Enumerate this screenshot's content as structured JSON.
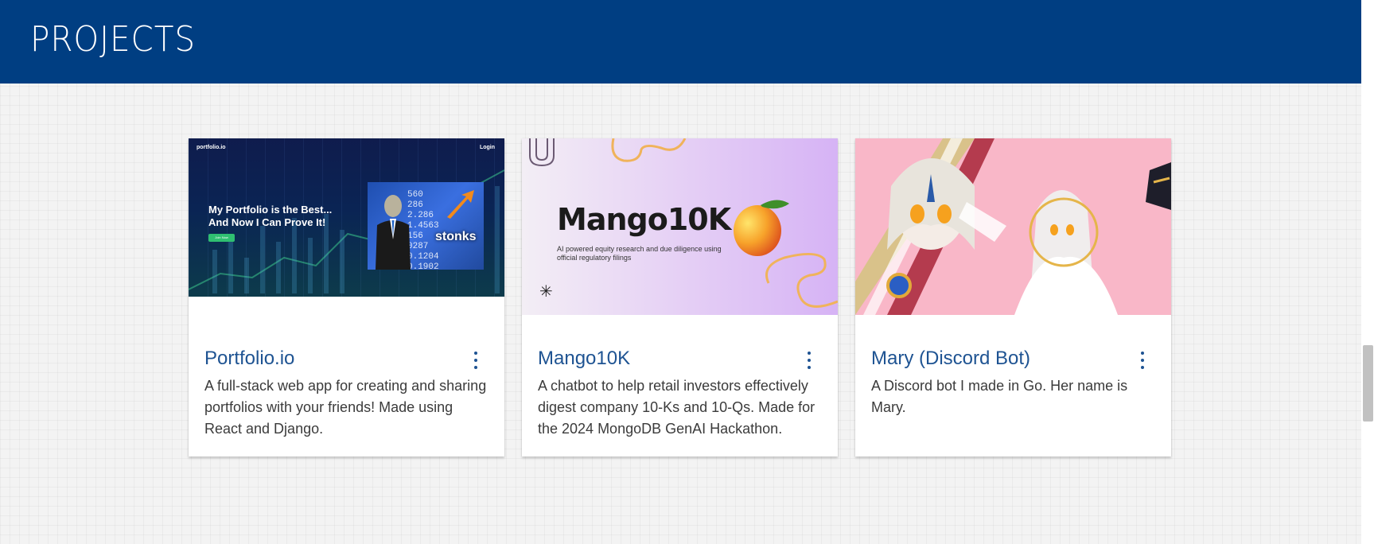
{
  "header": {
    "title": "PROJECTS"
  },
  "colors": {
    "header_bg": "#003e82",
    "title_accent": "#1e5392",
    "body_text": "#3b3b3b"
  },
  "projects": [
    {
      "title": "Portfolio.io",
      "description": "A full-stack web app for creating and sharing portfolios with your friends! Made using React and Django.",
      "menu_icon": "more-vert-icon",
      "image": {
        "logo": "portfolio.io",
        "login": "Login",
        "headline_1": "My Portfolio is the Best...",
        "headline_2": "And Now I Can Prove It!",
        "cta": "Join Now",
        "stock_numbers": [
          "560",
          "286",
          "2.286",
          "1.4563",
          "156",
          "0287",
          "0.1204",
          "0.1902"
        ],
        "meme_text": "stonks"
      }
    },
    {
      "title": "Mango10K",
      "description": "A chatbot to help retail investors effectively digest company 10-Ks and 10-Qs. Made for the 2024 MongoDB GenAI Hackathon.",
      "menu_icon": "more-vert-icon",
      "image": {
        "title": "Mango10K",
        "subtitle": "AI powered equity research and due diligence using official regulatory filings",
        "star": "✳"
      }
    },
    {
      "title": "Mary (Discord Bot)",
      "description": "A Discord bot I made in Go. Her name is Mary.",
      "menu_icon": "more-vert-icon",
      "image": {}
    }
  ]
}
